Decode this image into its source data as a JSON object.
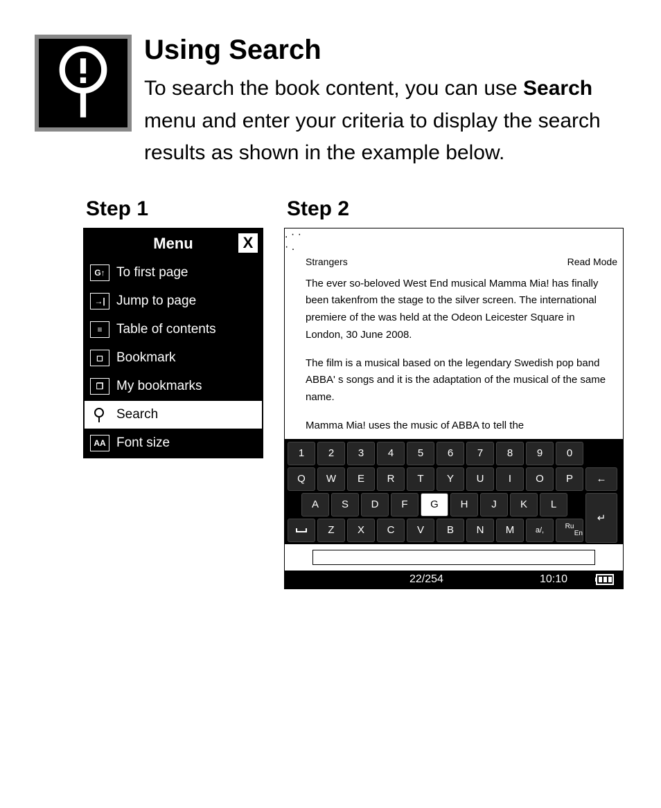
{
  "title": "Using Search",
  "intro_pre": "To search the book content, you can use ",
  "intro_bold": "Search",
  "intro_post": " menu and enter your criteria to display the search results as shown in the example below.",
  "step1_label": "Step 1",
  "step2_label": "Step 2",
  "menu": {
    "title": "Menu",
    "close": "X",
    "items": [
      {
        "label": "To first page"
      },
      {
        "label": "Jump to page"
      },
      {
        "label": "Table of contents"
      },
      {
        "label": "Bookmark"
      },
      {
        "label": "My bookmarks"
      },
      {
        "label": "Search"
      },
      {
        "label": "Font size"
      }
    ]
  },
  "reader": {
    "book_title": "Strangers",
    "mode": "Read Mode",
    "p1": "The ever so-beloved West End musical Mamma Mia! has finally been takenfrom the stage to the silver screen. The international premiere of the was held at the Odeon Leicester Square in London, 30 June 2008.",
    "p2": "The film is a musical based on the legendary Swedish pop band ABBA'  s songs and it is the adaptation of the musical of the same name.",
    "p3": "Mamma Mia! uses the music of ABBA to tell the"
  },
  "keyboard": {
    "row1": [
      "1",
      "2",
      "3",
      "4",
      "5",
      "6",
      "7",
      "8",
      "9",
      "0"
    ],
    "row2": [
      "Q",
      "W",
      "E",
      "R",
      "T",
      "Y",
      "U",
      "I",
      "O",
      "P"
    ],
    "row3": [
      "A",
      "S",
      "D",
      "F",
      "G",
      "H",
      "J",
      "K",
      "L"
    ],
    "row4": [
      "Z",
      "X",
      "C",
      "V",
      "B",
      "N",
      "M"
    ],
    "backspace": "←",
    "enter": "↵",
    "space": "␣",
    "sym": "a/,",
    "lang_top": "Ru",
    "lang_bot": "En",
    "highlighted": "G"
  },
  "status": {
    "page": "22/254",
    "time": "10:10"
  }
}
